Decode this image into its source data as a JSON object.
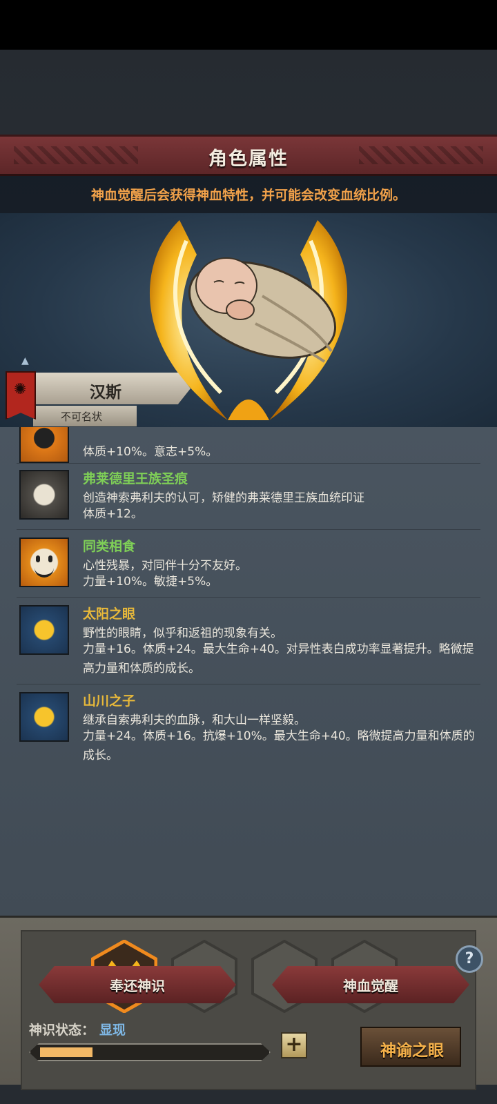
{
  "header": {
    "title": "角色属性"
  },
  "subtitle": "神血觉醒后会获得神血特性，并可能会改变血统比例。",
  "character": {
    "name": "汉斯",
    "title": "不可名状"
  },
  "traits": [
    {
      "name": "",
      "desc": "",
      "effect": "体质+10%。意志+5%。",
      "name_color": "#7fcf57",
      "icon": "orange-emblem-icon"
    },
    {
      "name": "弗莱德里王族圣痕",
      "desc": "创造神索弗利夫的认可，矫健的弗莱德里王族血统印证",
      "effect": "体质+12。",
      "name_color": "#7fcf57",
      "icon": "silver-crest-icon"
    },
    {
      "name": "同类相食",
      "desc": "心性残暴，对同伴十分不友好。",
      "effect": "力量+10%。敏捷+5%。",
      "name_color": "#7fcf57",
      "icon": "smiley-face-icon"
    },
    {
      "name": "太阳之眼",
      "desc": "野性的眼睛，似乎和返祖的现象有关。",
      "effect": "力量+16。体质+24。最大生命+40。对异性表白成功率显著提升。略微提高力量和体质的成长。",
      "name_color": "#e8b93a",
      "icon": "gold-crest-icon"
    },
    {
      "name": "山川之子",
      "desc": "继承自索弗利夫的血脉，和大山一样坚毅。",
      "effect": "力量+24。体质+16。抗爆+10%。最大生命+40。略微提高力量和体质的成长。",
      "name_color": "#e8b93a",
      "icon": "gold-crest-icon"
    }
  ],
  "ops": {
    "status_label": "神识状态：",
    "status_value": "显现",
    "progress": 0.24,
    "oracle_button": "神谕之眼",
    "help_symbol": "?",
    "plus_symbol": "+"
  },
  "buttons": {
    "return": "奉还神识",
    "awaken": "神血觉醒"
  }
}
